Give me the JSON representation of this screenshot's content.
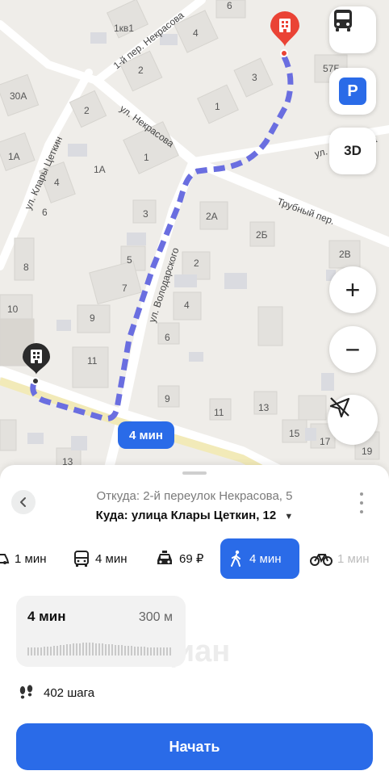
{
  "map": {
    "labels": [
      {
        "text": "1кв1"
      },
      {
        "text": "6"
      },
      {
        "text": "4"
      },
      {
        "text": "2"
      },
      {
        "text": "3"
      },
      {
        "text": "1"
      },
      {
        "text": "57Б"
      },
      {
        "text": "30А"
      },
      {
        "text": "2"
      },
      {
        "text": "1А"
      },
      {
        "text": "1А"
      },
      {
        "text": "4"
      },
      {
        "text": "6"
      },
      {
        "text": "1"
      },
      {
        "text": "3"
      },
      {
        "text": "2А"
      },
      {
        "text": "2Б"
      },
      {
        "text": "5"
      },
      {
        "text": "2"
      },
      {
        "text": "2В"
      },
      {
        "text": "8"
      },
      {
        "text": "7"
      },
      {
        "text": "4"
      },
      {
        "text": "10"
      },
      {
        "text": "9"
      },
      {
        "text": "6"
      },
      {
        "text": "11"
      },
      {
        "text": "9"
      },
      {
        "text": "13"
      },
      {
        "text": "11"
      },
      {
        "text": "15"
      },
      {
        "text": "17"
      },
      {
        "text": "19"
      },
      {
        "text": "13"
      }
    ],
    "streets": {
      "nekrasova_lane": "1-й пер. Некрасова",
      "nekrasova_street": "ул. Некрасова",
      "nekrasova_street_right": "ул. Некрасова",
      "trubny": "Трубный пер.",
      "zetkin": "ул. Клары Цеткин",
      "volodarskogo": "ул. Володарского"
    },
    "route_time": "4 мин",
    "controls": {
      "transit_icon": "bus-icon",
      "parking_label": "P",
      "three_d_label": "3D",
      "zoom_in": "+",
      "zoom_out": "−"
    },
    "colors": {
      "route": "#6a6ee0",
      "accent": "#2a6be8",
      "pin": "#ea4335"
    }
  },
  "sheet": {
    "from": "Откуда: 2-й переулок Некрасова, 5",
    "to": "Куда: улица Клары Цеткин, 12",
    "modes": [
      {
        "icon": "car-icon",
        "label": "1 мин"
      },
      {
        "icon": "bus-icon",
        "label": "4 мин"
      },
      {
        "icon": "taxi-icon",
        "label": "69 ₽"
      },
      {
        "icon": "walk-icon",
        "label": "4 мин",
        "active": true
      },
      {
        "icon": "bike-icon",
        "label": "1 мин"
      }
    ],
    "card": {
      "duration": "4 мин",
      "distance": "300 м"
    },
    "steps": "402 шага",
    "start_button": "Начать",
    "watermark": "Циан"
  }
}
